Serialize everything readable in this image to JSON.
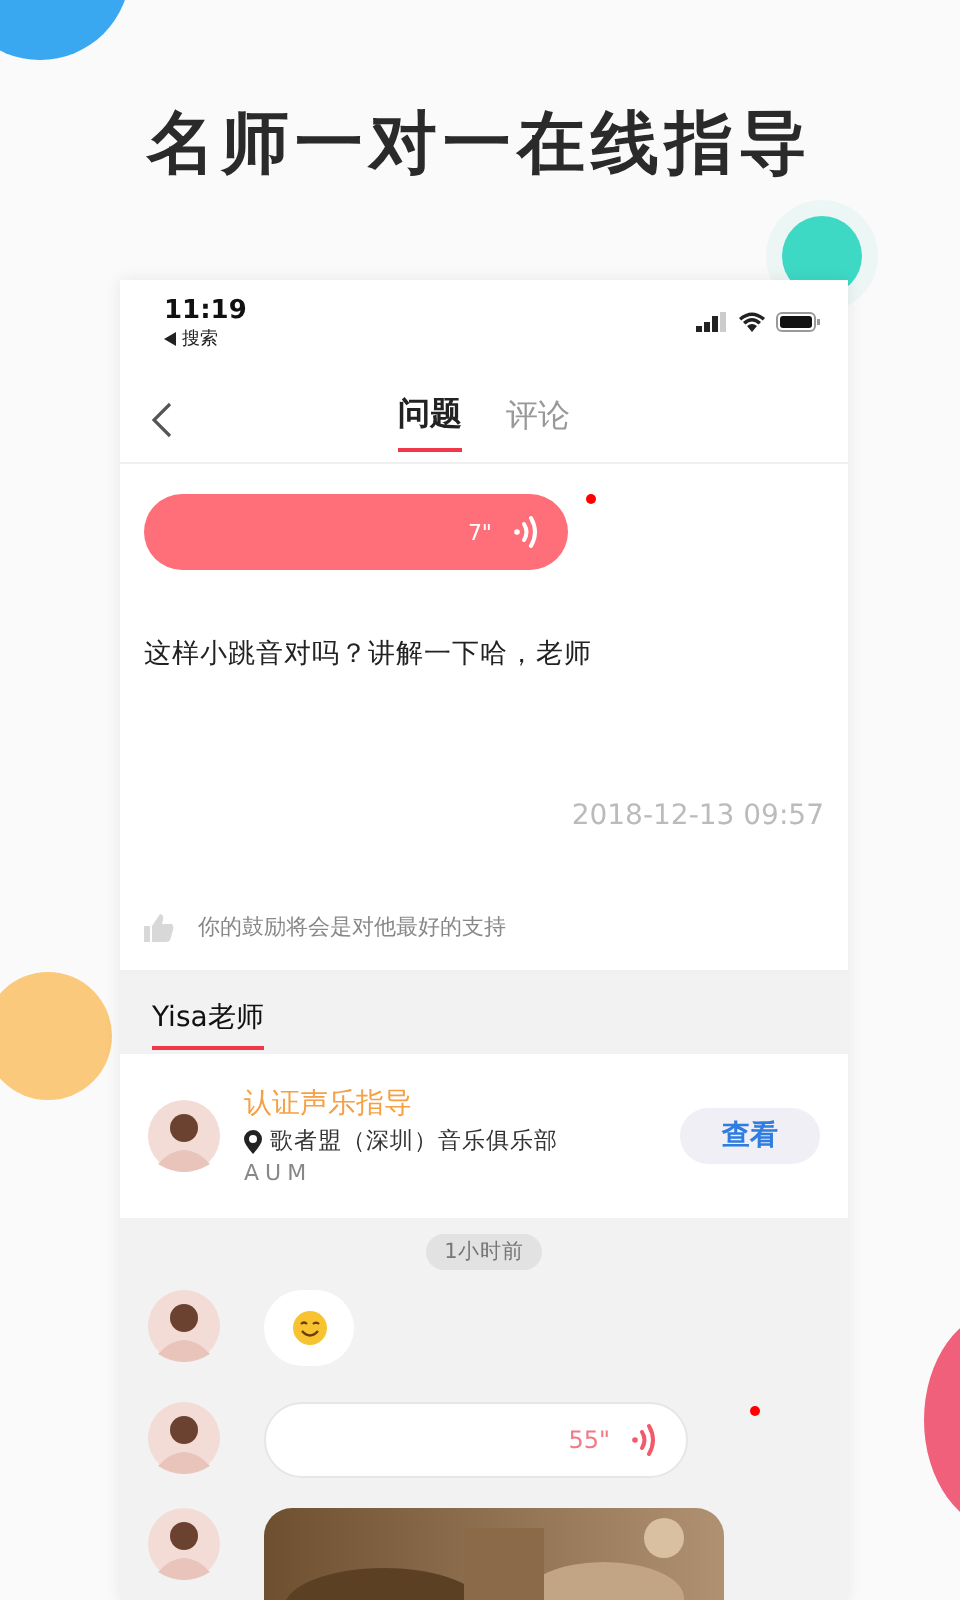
{
  "headline": "名师一对一在线指导",
  "status_bar": {
    "time": "11:19",
    "back_app": "搜索"
  },
  "tabs": [
    {
      "label": "问题",
      "selected": true
    },
    {
      "label": "评论",
      "selected": false
    }
  ],
  "question": {
    "voice": {
      "duration": "7\"",
      "unread": true
    },
    "text": "这样小跳音对吗？讲解一下哈，老师",
    "time": "2018-12-13 09:57",
    "encourage": "你的鼓励将会是对他最好的支持"
  },
  "teacher": {
    "tab_label": "Yisa老师",
    "title": "认证声乐指导",
    "location": "歌者盟（深圳）音乐俱乐部",
    "org": "AUM",
    "button": "查看"
  },
  "chat": {
    "time_badge": "1小时前",
    "messages": [
      {
        "kind": "emoji"
      },
      {
        "kind": "voice",
        "duration": "55\"",
        "unread": true
      },
      {
        "kind": "picture"
      }
    ]
  }
}
